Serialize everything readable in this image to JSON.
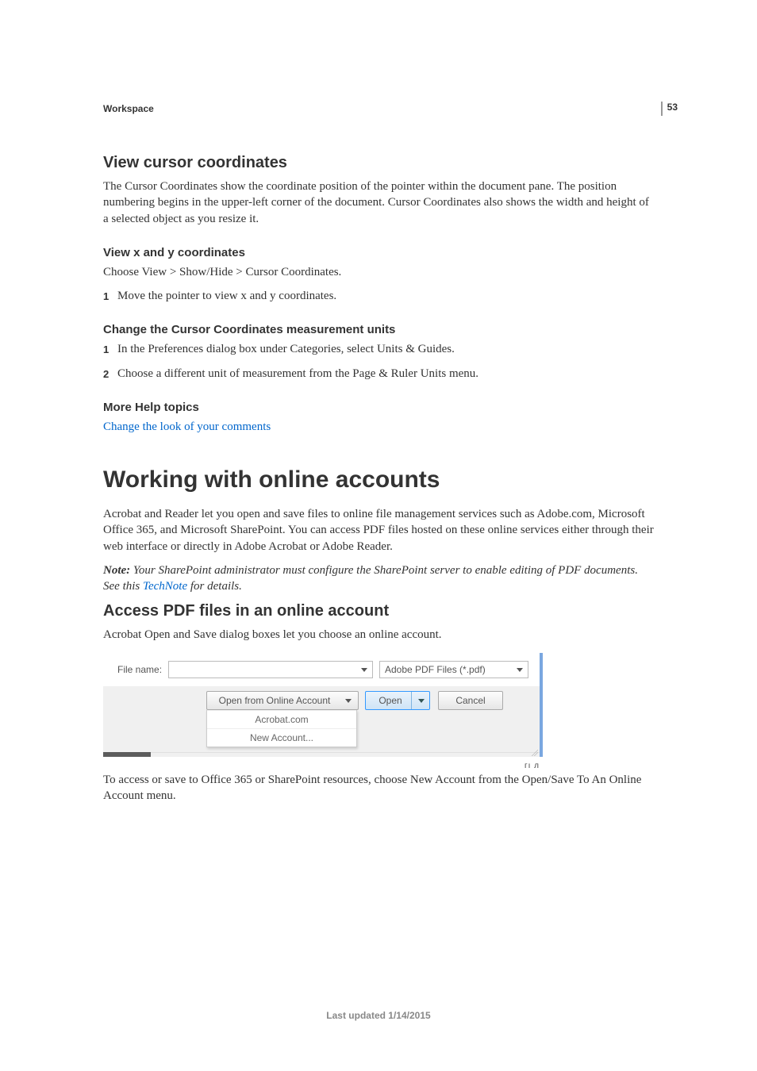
{
  "page_number": "53",
  "header_section": "Workspace",
  "sec1": {
    "title": "View cursor coordinates",
    "intro": "The Cursor Coordinates show the coordinate position of the pointer within the document pane. The position numbering begins in the upper-left corner of the document. Cursor Coordinates also shows the width and height of a selected object as you resize it.",
    "sub1_title": "View x and y coordinates",
    "sub1_line": "Choose View > Show/Hide > Cursor Coordinates.",
    "sub1_step1_num": "1",
    "sub1_step1": "Move the pointer to view x and y coordinates.",
    "sub2_title": "Change the Cursor Coordinates measurement units",
    "sub2_step1_num": "1",
    "sub2_step1": "In the Preferences dialog box under Categories, select Units & Guides.",
    "sub2_step2_num": "2",
    "sub2_step2": "Choose a different unit of measurement from the Page & Ruler Units menu.",
    "more_help_title": "More Help topics",
    "more_help_link": "Change the look of your comments"
  },
  "sec2": {
    "title": "Working with online accounts",
    "p1": "Acrobat and Reader let you open and save files to online file management services such as Adobe.com, Microsoft Office 365, and Microsoft SharePoint. You can access PDF files hosted on these online services either through their web interface or directly in Adobe Acrobat or Adobe Reader.",
    "note_label": "Note: ",
    "note_body_a": "Your SharePoint administrator must configure the SharePoint server to enable editing of PDF documents. See this ",
    "note_link": "TechNote",
    "note_body_b": " for details.",
    "sub1_title": "Access PDF files in an online account",
    "sub1_p": "Acrobat Open and Save dialog boxes let you choose an online account.",
    "caption": "To access or save to Office 365 or SharePoint resources, choose New Account from the Open/Save To An Online Account menu."
  },
  "dialog": {
    "filename_label": "File name:",
    "filetype": "Adobe PDF Files (*.pdf)",
    "open_from": "Open from Online Account",
    "open": "Open",
    "cancel": "Cancel",
    "menu_item1": "Acrobat.com",
    "menu_item2": "New Account...",
    "trailing_mark": "гı л"
  },
  "footer": "Last updated 1/14/2015"
}
